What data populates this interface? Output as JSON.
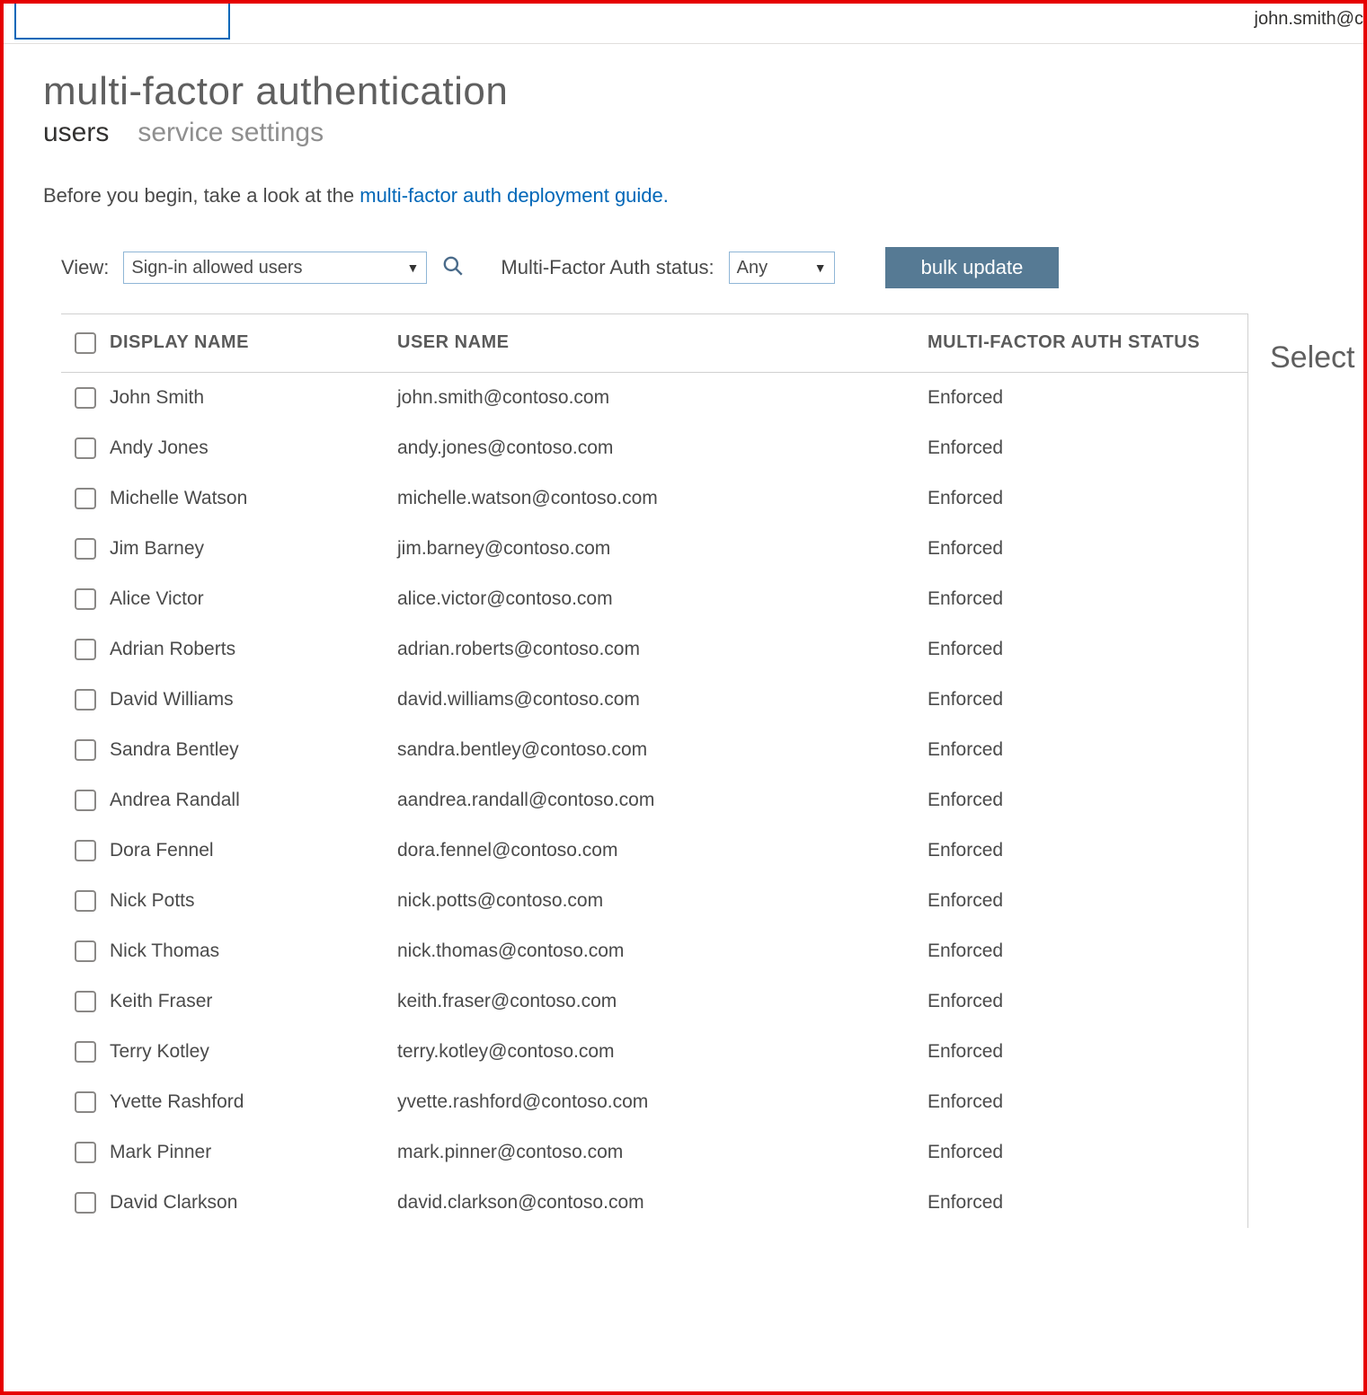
{
  "topbar": {
    "user_email": "john.smith@c"
  },
  "page": {
    "title": "multi-factor authentication"
  },
  "tabs": {
    "users": "users",
    "service_settings": "service settings"
  },
  "intro": {
    "prefix": "Before you begin, take a look at the ",
    "link": "multi-factor auth deployment guide.",
    "suffix": ""
  },
  "filters": {
    "view_label": "View:",
    "view_value": "Sign-in allowed users",
    "status_label": "Multi-Factor Auth status:",
    "status_value": "Any",
    "bulk_update": "bulk update"
  },
  "columns": {
    "display_name": "DISPLAY NAME",
    "user_name": "USER NAME",
    "mfa_status": "MULTI-FACTOR AUTH STATUS"
  },
  "side": {
    "title": "Select"
  },
  "rows": [
    {
      "display_name": "John Smith",
      "user_name": "john.smith@contoso.com",
      "status": "Enforced"
    },
    {
      "display_name": "Andy Jones",
      "user_name": "andy.jones@contoso.com",
      "status": "Enforced"
    },
    {
      "display_name": "Michelle Watson",
      "user_name": "michelle.watson@contoso.com",
      "status": "Enforced"
    },
    {
      "display_name": "Jim Barney",
      "user_name": "jim.barney@contoso.com",
      "status": "Enforced"
    },
    {
      "display_name": "Alice Victor",
      "user_name": "alice.victor@contoso.com",
      "status": "Enforced"
    },
    {
      "display_name": "Adrian Roberts",
      "user_name": "adrian.roberts@contoso.com",
      "status": "Enforced"
    },
    {
      "display_name": "David Williams",
      "user_name": "david.williams@contoso.com",
      "status": "Enforced"
    },
    {
      "display_name": "Sandra Bentley",
      "user_name": "sandra.bentley@contoso.com",
      "status": "Enforced"
    },
    {
      "display_name": "Andrea Randall",
      "user_name": "aandrea.randall@contoso.com",
      "status": "Enforced"
    },
    {
      "display_name": "Dora Fennel",
      "user_name": "dora.fennel@contoso.com",
      "status": "Enforced"
    },
    {
      "display_name": "Nick Potts",
      "user_name": "nick.potts@contoso.com",
      "status": "Enforced"
    },
    {
      "display_name": "Nick Thomas",
      "user_name": "nick.thomas@contoso.com",
      "status": "Enforced"
    },
    {
      "display_name": "Keith Fraser",
      "user_name": "keith.fraser@contoso.com",
      "status": "Enforced"
    },
    {
      "display_name": "Terry Kotley",
      "user_name": "terry.kotley@contoso.com",
      "status": "Enforced"
    },
    {
      "display_name": "Yvette Rashford",
      "user_name": "yvette.rashford@contoso.com",
      "status": "Enforced"
    },
    {
      "display_name": "Mark Pinner",
      "user_name": "mark.pinner@contoso.com",
      "status": "Enforced"
    },
    {
      "display_name": "David Clarkson",
      "user_name": "david.clarkson@contoso.com",
      "status": "Enforced"
    }
  ]
}
